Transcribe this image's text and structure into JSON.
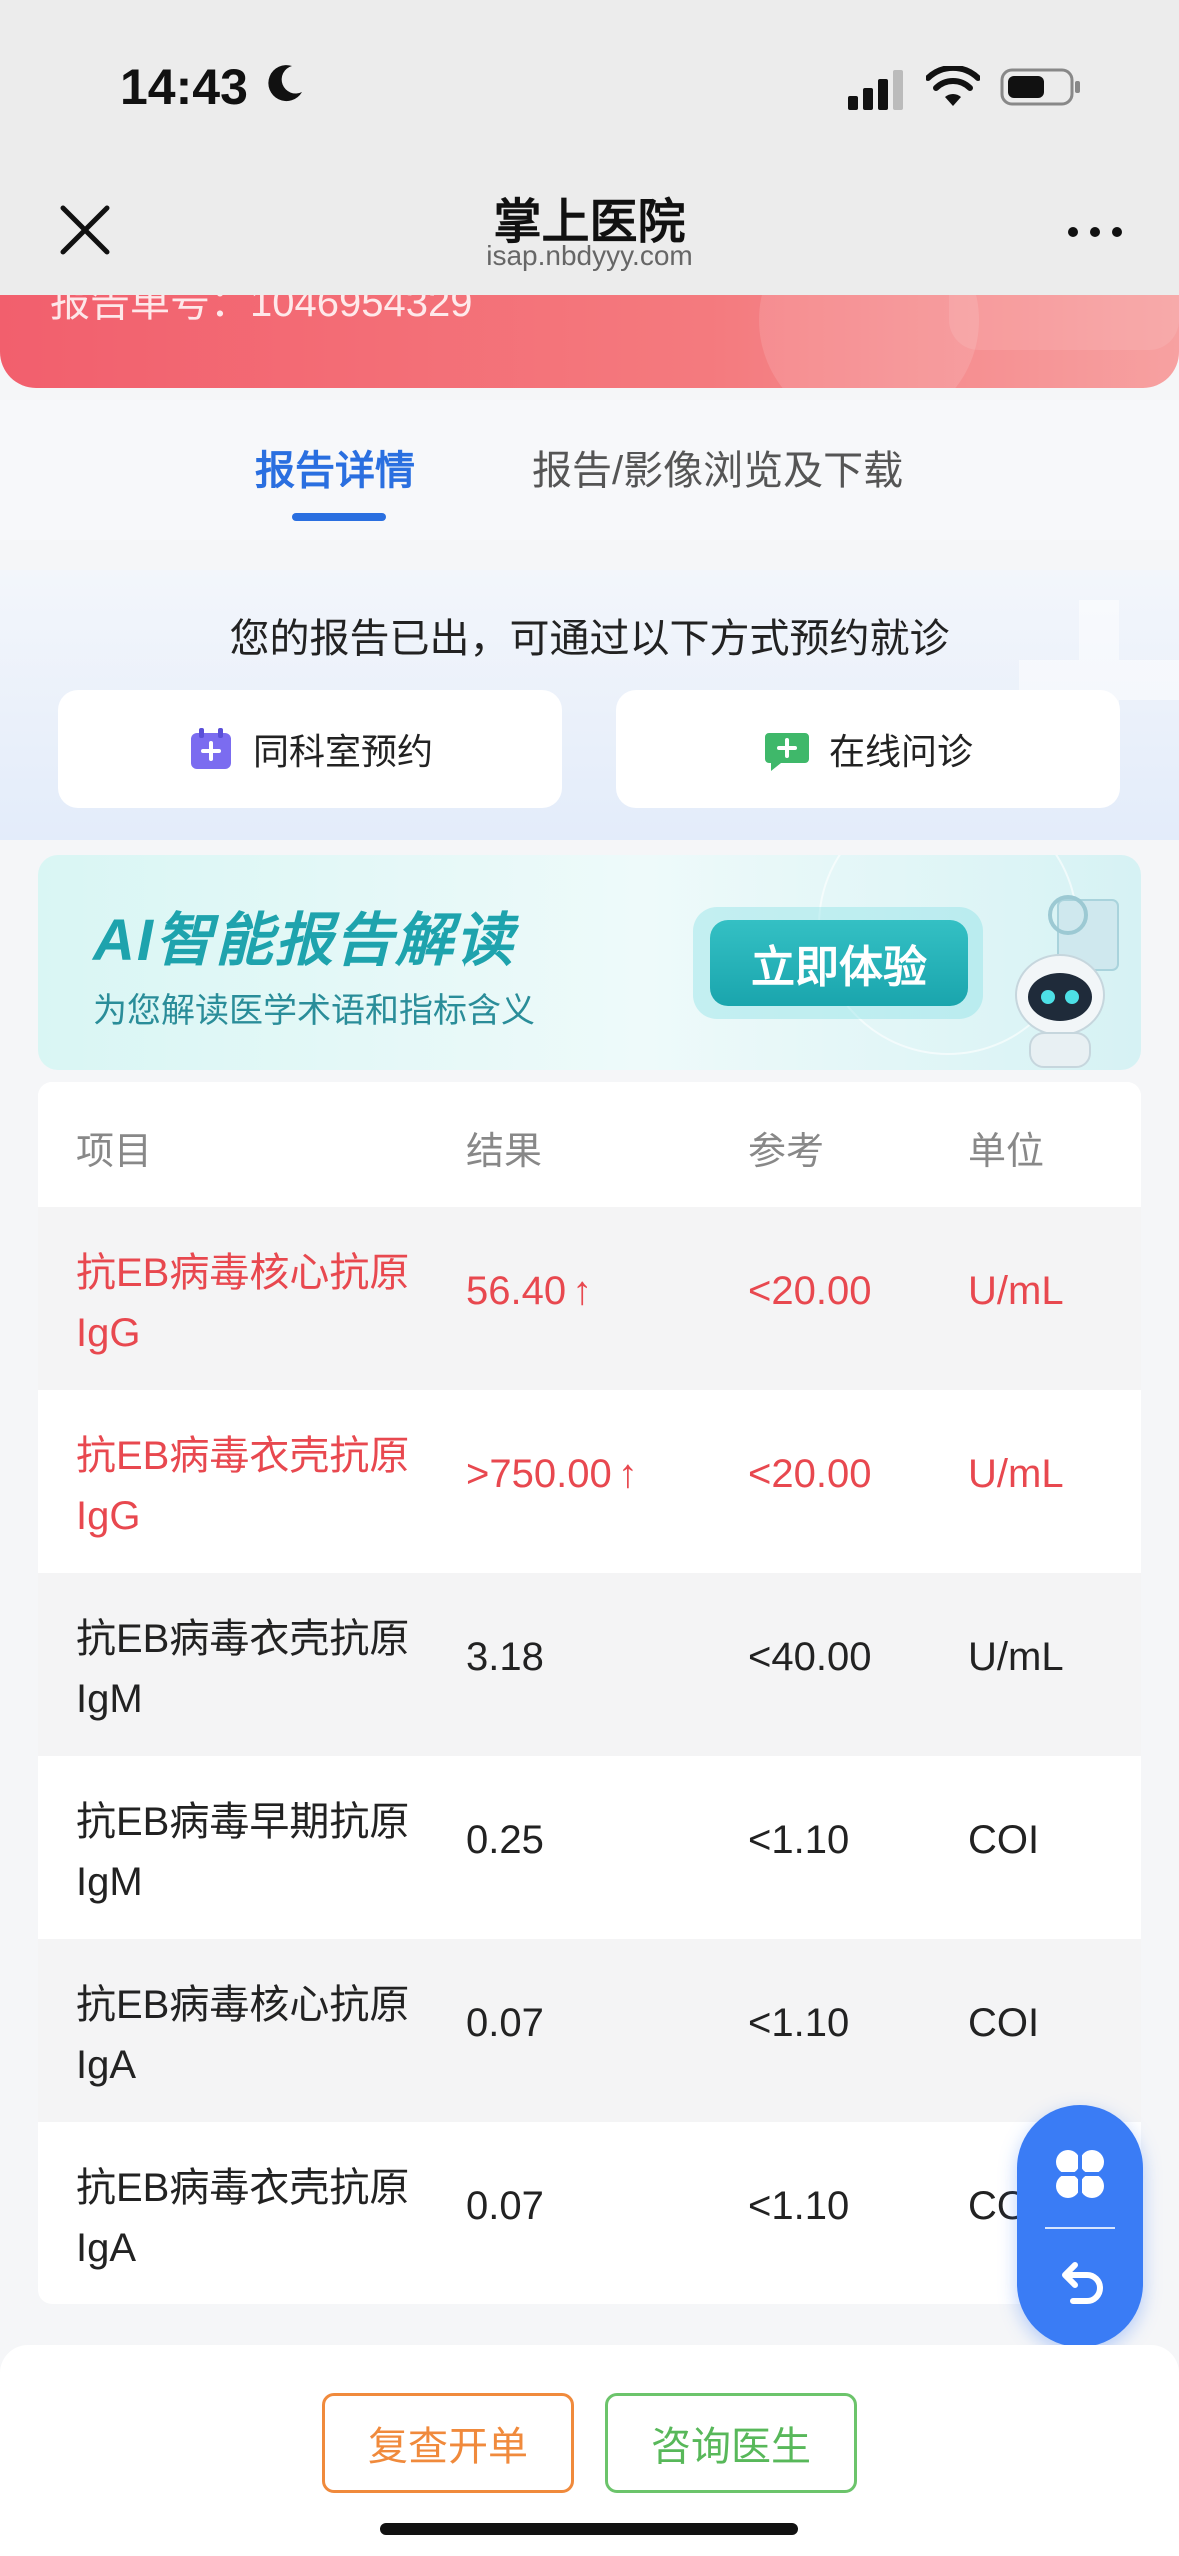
{
  "status_bar": {
    "time": "14:43"
  },
  "nav": {
    "title": "掌上医院",
    "url": "isap.nbdyyy.com"
  },
  "header": {
    "partial_text": "报告单号：1046954329"
  },
  "tabs": [
    {
      "label": "报告详情",
      "active": true
    },
    {
      "label": "报告/影像浏览及下载",
      "active": false
    }
  ],
  "appointment": {
    "title": "您的报告已出，可通过以下方式预约就诊",
    "buttons": [
      {
        "label": "同科室预约",
        "icon": "calendar-plus-icon"
      },
      {
        "label": "在线问诊",
        "icon": "chat-plus-icon"
      }
    ]
  },
  "ai_banner": {
    "title": "AI智能报告解读",
    "subtitle": "为您解读医学术语和指标含义",
    "button": "立即体验"
  },
  "table": {
    "headers": [
      "项目",
      "结果",
      "参考",
      "单位"
    ],
    "rows": [
      {
        "name": "抗EB病毒核心抗原IgG",
        "result": "56.40",
        "flag": "↑",
        "reference": "<20.00",
        "unit": "U/mL",
        "abnormal": true
      },
      {
        "name": "抗EB病毒衣壳抗原IgG",
        "result": ">750.00",
        "flag": "↑",
        "reference": "<20.00",
        "unit": "U/mL",
        "abnormal": true
      },
      {
        "name": "抗EB病毒衣壳抗原IgM",
        "result": "3.18",
        "flag": "",
        "reference": "<40.00",
        "unit": "U/mL",
        "abnormal": false
      },
      {
        "name": "抗EB病毒早期抗原IgM",
        "result": "0.25",
        "flag": "",
        "reference": "<1.10",
        "unit": "COI",
        "abnormal": false
      },
      {
        "name": "抗EB病毒核心抗原IgA",
        "result": "0.07",
        "flag": "",
        "reference": "<1.10",
        "unit": "COI",
        "abnormal": false
      },
      {
        "name": "抗EB病毒衣壳抗原IgA",
        "result": "0.07",
        "flag": "",
        "reference": "<1.10",
        "unit": "COI",
        "abnormal": false
      }
    ]
  },
  "bottom_bar": {
    "recheck": "复查开单",
    "consult": "咨询医生"
  },
  "colors": {
    "accent": "#2a6fe0",
    "abnormal": "#e8484f",
    "orange": "#f08a3c",
    "green": "#58b85a"
  }
}
